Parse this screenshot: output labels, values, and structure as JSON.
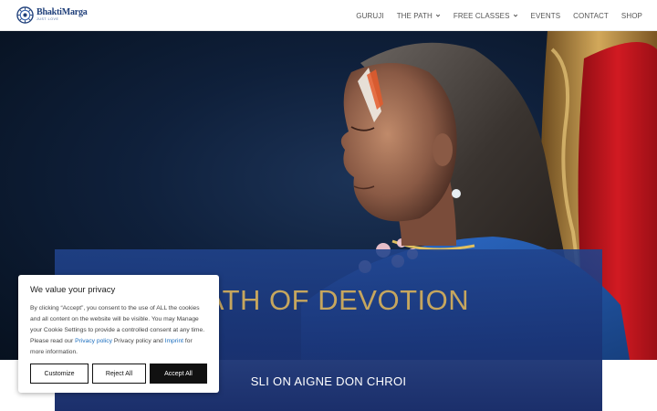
{
  "header": {
    "logo": {
      "name": "BhaktiMarga",
      "tagline": "JUST LOVE"
    },
    "nav": [
      {
        "label": "GURUJI",
        "dropdown": false
      },
      {
        "label": "THE PATH",
        "dropdown": true
      },
      {
        "label": "FREE CLASSES",
        "dropdown": true
      },
      {
        "label": "EVENTS",
        "dropdown": false
      },
      {
        "label": "CONTACT",
        "dropdown": false
      },
      {
        "label": "SHOP",
        "dropdown": false
      }
    ]
  },
  "hero": {
    "title": "PATH OF DEVOTION",
    "subtitle": "SLI ON AIGNE DON CHROI"
  },
  "cookie": {
    "title": "We value your privacy",
    "text_1": "By clicking “Accept”, you consent to the use of ALL the cookies and all content on the website will be visible. You may Manage your Cookie Settings to provide a controlled consent at any time. Please read our ",
    "link_privacy": "Privacy policy",
    "text_2": " Privacy policy and ",
    "link_imprint": "Imprint",
    "text_3": " for more information.",
    "buttons": {
      "customize": "Customize",
      "reject": "Reject All",
      "accept": "Accept All"
    }
  },
  "colors": {
    "brand_blue": "#1f3f7a",
    "title_gold": "#c6a65e",
    "banner_blue": "#20438c",
    "link_blue": "#1d6fbf",
    "throne_red": "#c4121c",
    "throne_gold": "#b8873a"
  }
}
